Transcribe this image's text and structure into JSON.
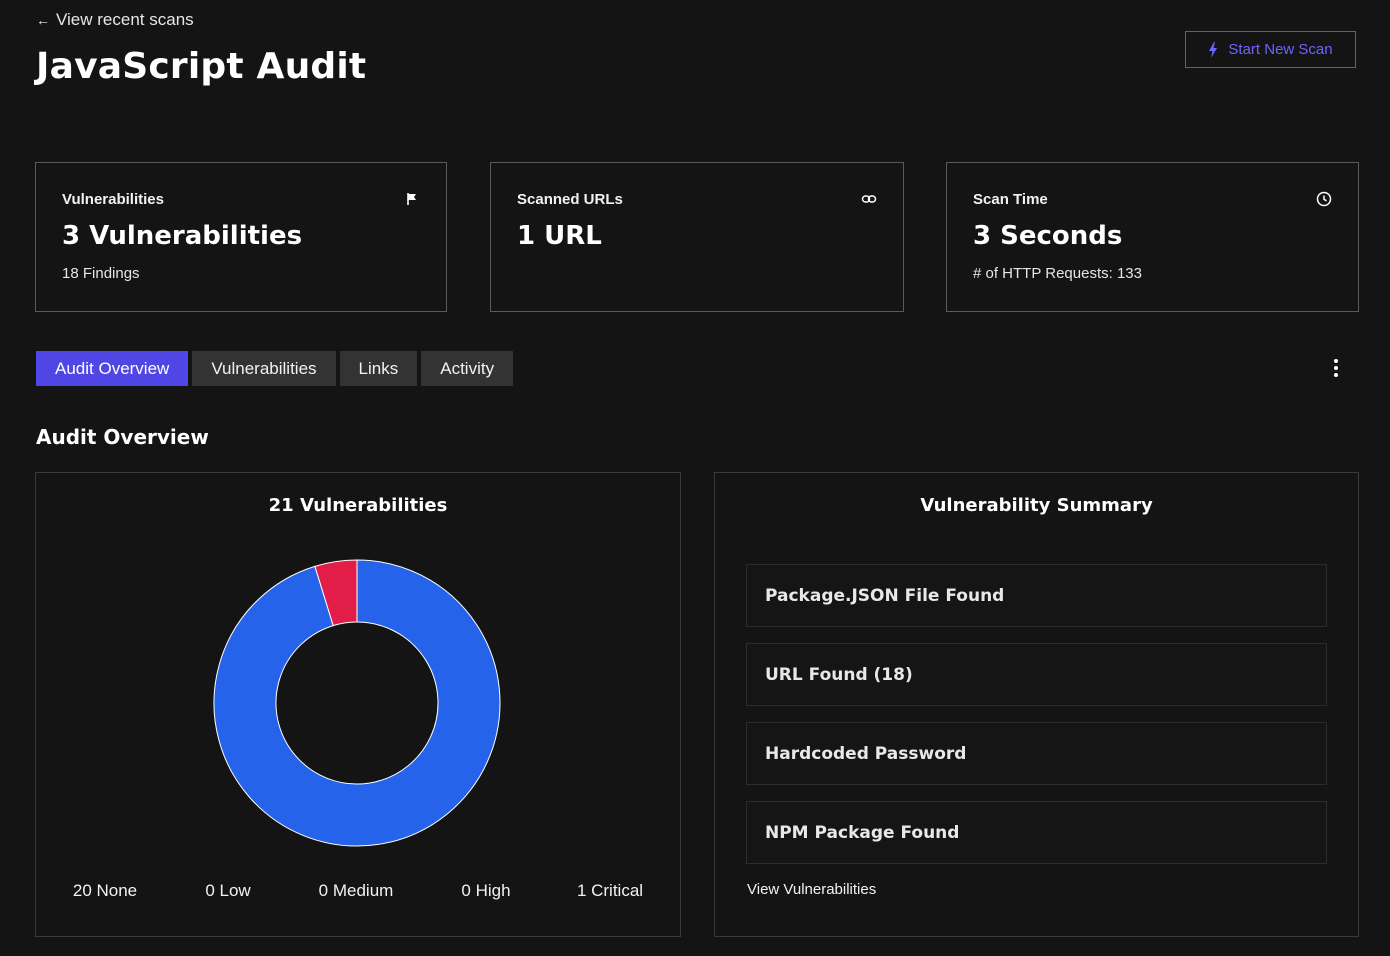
{
  "header": {
    "back_link": "View recent scans",
    "title": "JavaScript Audit",
    "start_scan_label": "Start New Scan",
    "accent_color": "#5b4cf0"
  },
  "stats": [
    {
      "label": "Vulnerabilities",
      "value": "3 Vulnerabilities",
      "sub": "18 Findings",
      "icon": "flag-icon"
    },
    {
      "label": "Scanned URLs",
      "value": "1 URL",
      "sub": "",
      "icon": "link-icon"
    },
    {
      "label": "Scan Time",
      "value": "3 Seconds",
      "sub": "# of HTTP Requests: 133",
      "icon": "clock-icon"
    }
  ],
  "tabs": [
    {
      "label": "Audit Overview",
      "active": true
    },
    {
      "label": "Vulnerabilities",
      "active": false
    },
    {
      "label": "Links",
      "active": false
    },
    {
      "label": "Activity",
      "active": false
    }
  ],
  "section_title": "Audit Overview",
  "chart_panel": {
    "title": "21 Vulnerabilities",
    "legend": [
      "20 None",
      "0 Low",
      "0 Medium",
      "0 High",
      "1 Critical"
    ]
  },
  "chart_data": {
    "type": "pie",
    "title": "21 Vulnerabilities",
    "categories": [
      "None",
      "Low",
      "Medium",
      "High",
      "Critical"
    ],
    "values": [
      20,
      0,
      0,
      0,
      1
    ],
    "colors": [
      "#2563eb",
      "#3b82f6",
      "#f59e0b",
      "#f97316",
      "#e11d48"
    ],
    "donut": true
  },
  "summary_panel": {
    "title": "Vulnerability Summary",
    "items": [
      "Package.JSON File Found",
      "URL Found (18)",
      "Hardcoded Password",
      "NPM Package Found"
    ],
    "view_link": "View Vulnerabilities"
  }
}
